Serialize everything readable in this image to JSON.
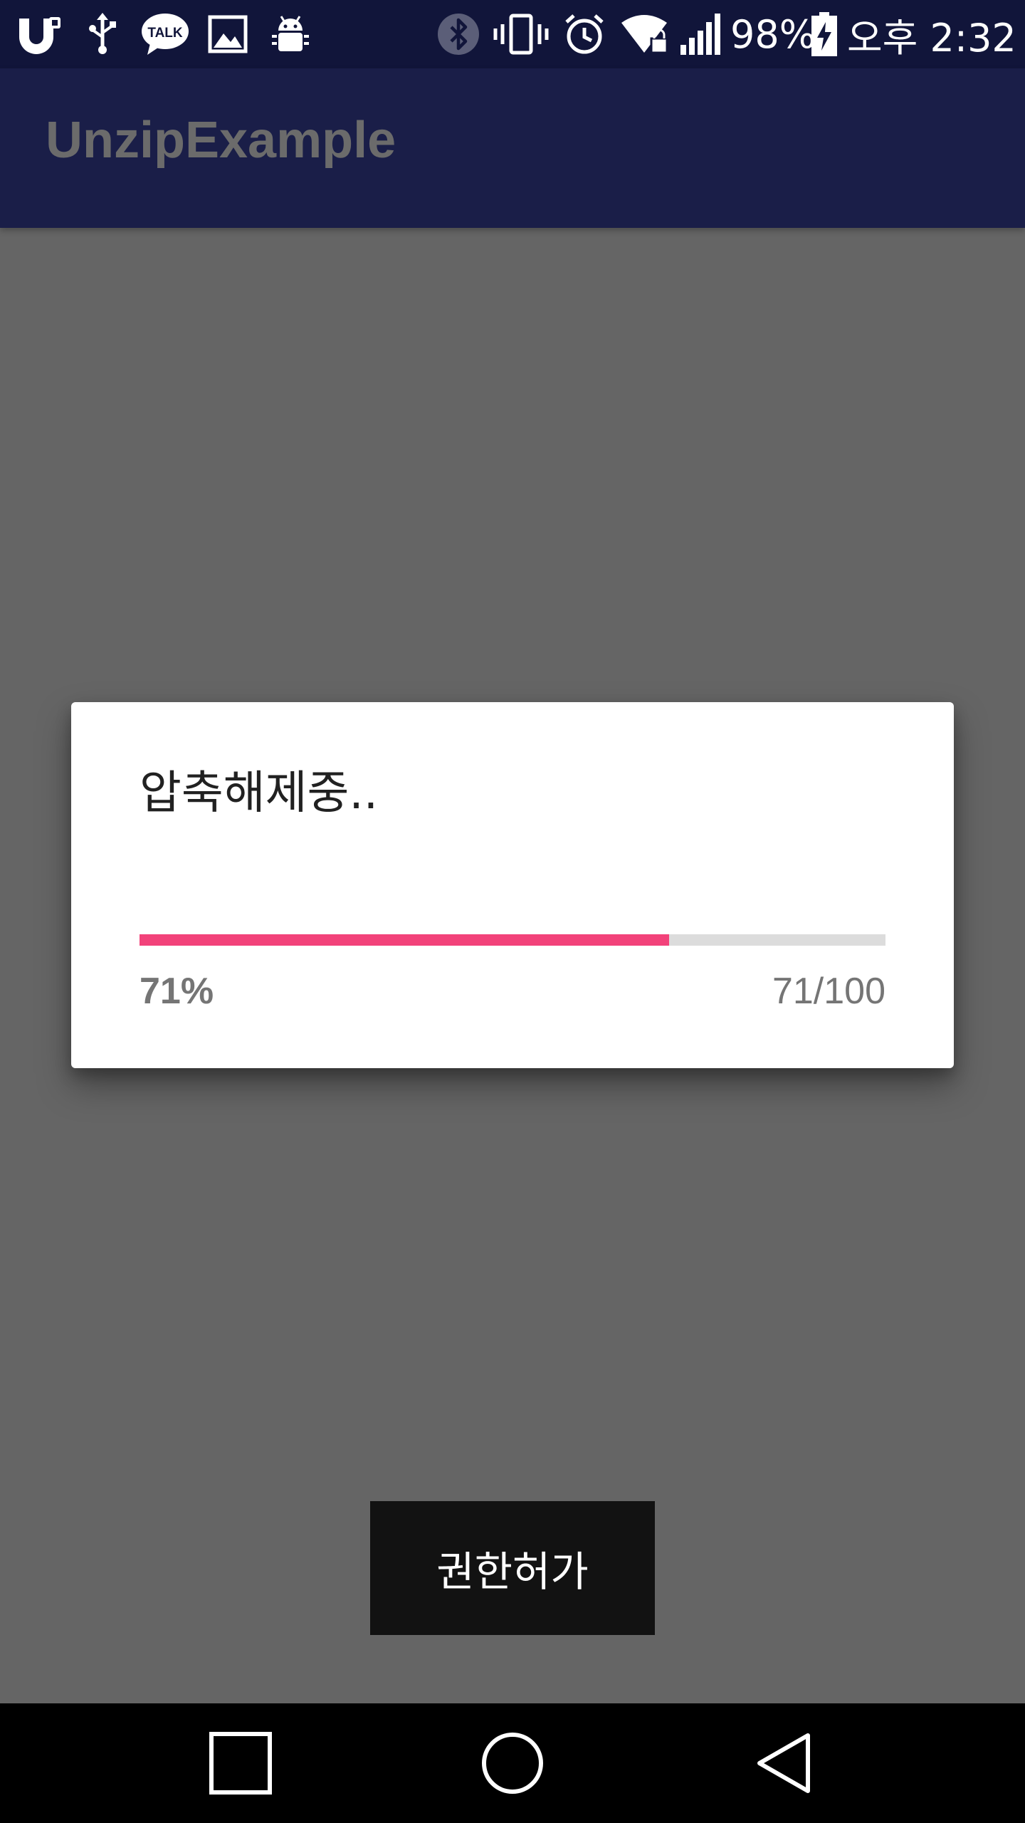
{
  "status_bar": {
    "battery_percent": "98%",
    "time": "오후 2:32",
    "icons": [
      "uplus-icon",
      "usb-icon",
      "kakaotalk-icon",
      "gallery-icon",
      "android-debug-icon",
      "bluetooth-icon",
      "vibrate-icon",
      "alarm-icon",
      "wifi-icon",
      "signal-icon",
      "battery-charging-icon"
    ],
    "talk_label": "TALK",
    "background": "#11153a"
  },
  "app_bar": {
    "title": "UnzipExample",
    "background": "#1a1e48"
  },
  "dialog": {
    "title": "압축해제중..",
    "progress": 0.71,
    "percent_label": "71%",
    "count_label": "71/100",
    "accent_color": "#f2427a"
  },
  "main": {
    "permission_button_label": "권한허가"
  },
  "nav_bar": {
    "buttons": [
      "recents-icon",
      "home-icon",
      "back-icon"
    ]
  }
}
